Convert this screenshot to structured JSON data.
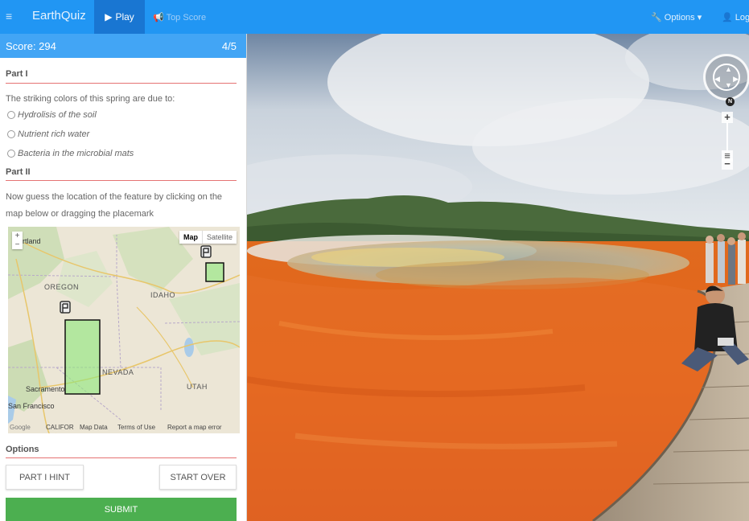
{
  "navbar": {
    "menu_icon": "hamburger-icon",
    "brand": "EarthQuiz",
    "play_label": "Play",
    "play_icon": "play-icon",
    "top_score_label": "Top Score",
    "top_score_icon": "megaphone-icon",
    "options_label": "Options",
    "options_icon": "wrench-icon",
    "log_label": "Log",
    "log_icon": "user-icon",
    "color": "#2196f3",
    "active_color": "#1976d2"
  },
  "score_bar": {
    "score_text": "Score: 294",
    "progress_text": "4/5",
    "color": "#42a5f5"
  },
  "part1": {
    "title": "Part I",
    "question": "The striking colors of this spring are due to:",
    "choices": [
      "Hydrolisis of the soil",
      "Nutrient rich water",
      "Bacteria in the microbial mats"
    ]
  },
  "part2": {
    "title": "Part II",
    "instruction": "Now guess the location of the feature by clicking on the map below or dragging the placemark"
  },
  "minimap": {
    "map_button": "Map",
    "satellite_button": "Satellite",
    "zoom_in": "+",
    "zoom_out": "−",
    "labels": {
      "portland": "rtland",
      "oregon": "OREGON",
      "idaho": "IDAHO",
      "nevada": "NEVADA",
      "utah": "UTAH",
      "sacramento": "Sacramento",
      "san_francisco": "San Francisco",
      "california": "CALIFOR",
      "google": "Google"
    },
    "footer": {
      "map_data": "Map Data",
      "terms": "Terms of Use",
      "report": "Report a map error"
    }
  },
  "options": {
    "title": "Options",
    "hint_button": "PART I HINT",
    "start_over_button": "START OVER",
    "submit_button": "SUBMIT",
    "submit_color": "#4caf50"
  },
  "streetview": {
    "compass_letter": "N",
    "zoom_in": "+",
    "zoom_out": "−"
  },
  "colors": {
    "section_rule": "#e57373"
  }
}
